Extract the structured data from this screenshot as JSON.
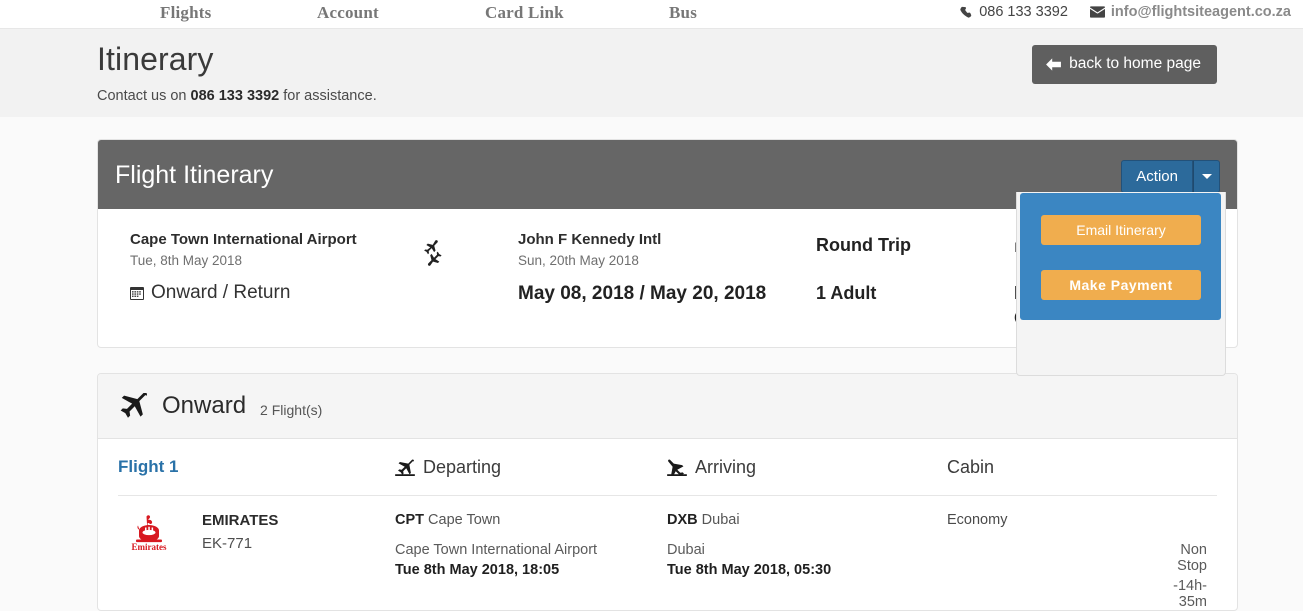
{
  "nav": {
    "items": [
      {
        "label": "Flights"
      },
      {
        "label": "Account"
      },
      {
        "label": "Card Link"
      },
      {
        "label": "Bus"
      }
    ],
    "phone": "086 133 3392",
    "email": "info@flightsiteagent.co.za"
  },
  "header": {
    "title": "Itinerary",
    "contact_prefix": "Contact us on ",
    "contact_phone": "086 133 3392",
    "contact_suffix": " for assistance.",
    "back_button": "back to home page"
  },
  "itinerary_card": {
    "title": "Flight Itinerary",
    "action_button": "Action",
    "summary": {
      "origin_airport": "Cape Town International Airport",
      "origin_date": "Tue, 8th May 2018",
      "destination_airport": "John F Kennedy Intl",
      "destination_date": "Sun, 20th May 2018",
      "trip_type": "Round Trip",
      "passengers": "1 Adult",
      "booking_label": "Bo",
      "dates_label": "Onward / Return",
      "dates_value": "May 08, 2018 / May 20, 2018",
      "status_line1": "B",
      "status_line2": "O"
    }
  },
  "action_panel": {
    "email_itinerary": "Email Itinerary",
    "make_payment": "Make Payment"
  },
  "onward": {
    "title": "Onward",
    "count": "2 Flight(s)",
    "columns": {
      "flight": "Flight 1",
      "departing": "Departing",
      "arriving": "Arriving",
      "cabin": "Cabin"
    },
    "flight": {
      "airline": "EMIRATES",
      "flight_number": "EK-771",
      "airline_logo_text": "Emirates",
      "depart_code": "CPT",
      "depart_city": "Cape Town",
      "depart_airport": "Cape Town International Airport",
      "depart_time": "Tue 8th May 2018, 18:05",
      "arrive_code": "DXB",
      "arrive_city": "Dubai",
      "arrive_airport": "Dubai",
      "arrive_time": "Tue 8th May 2018, 05:30",
      "cabin": "Economy",
      "stops": "Non Stop",
      "duration": "-14h-35m"
    }
  },
  "colors": {
    "accent_blue": "#2c6a9b",
    "panel_blue": "#3b86c2",
    "panel_orange": "#f0ad4e",
    "card_header_gray": "#666666",
    "link_blue": "#2a72a8",
    "emirates_red": "#d71921"
  }
}
